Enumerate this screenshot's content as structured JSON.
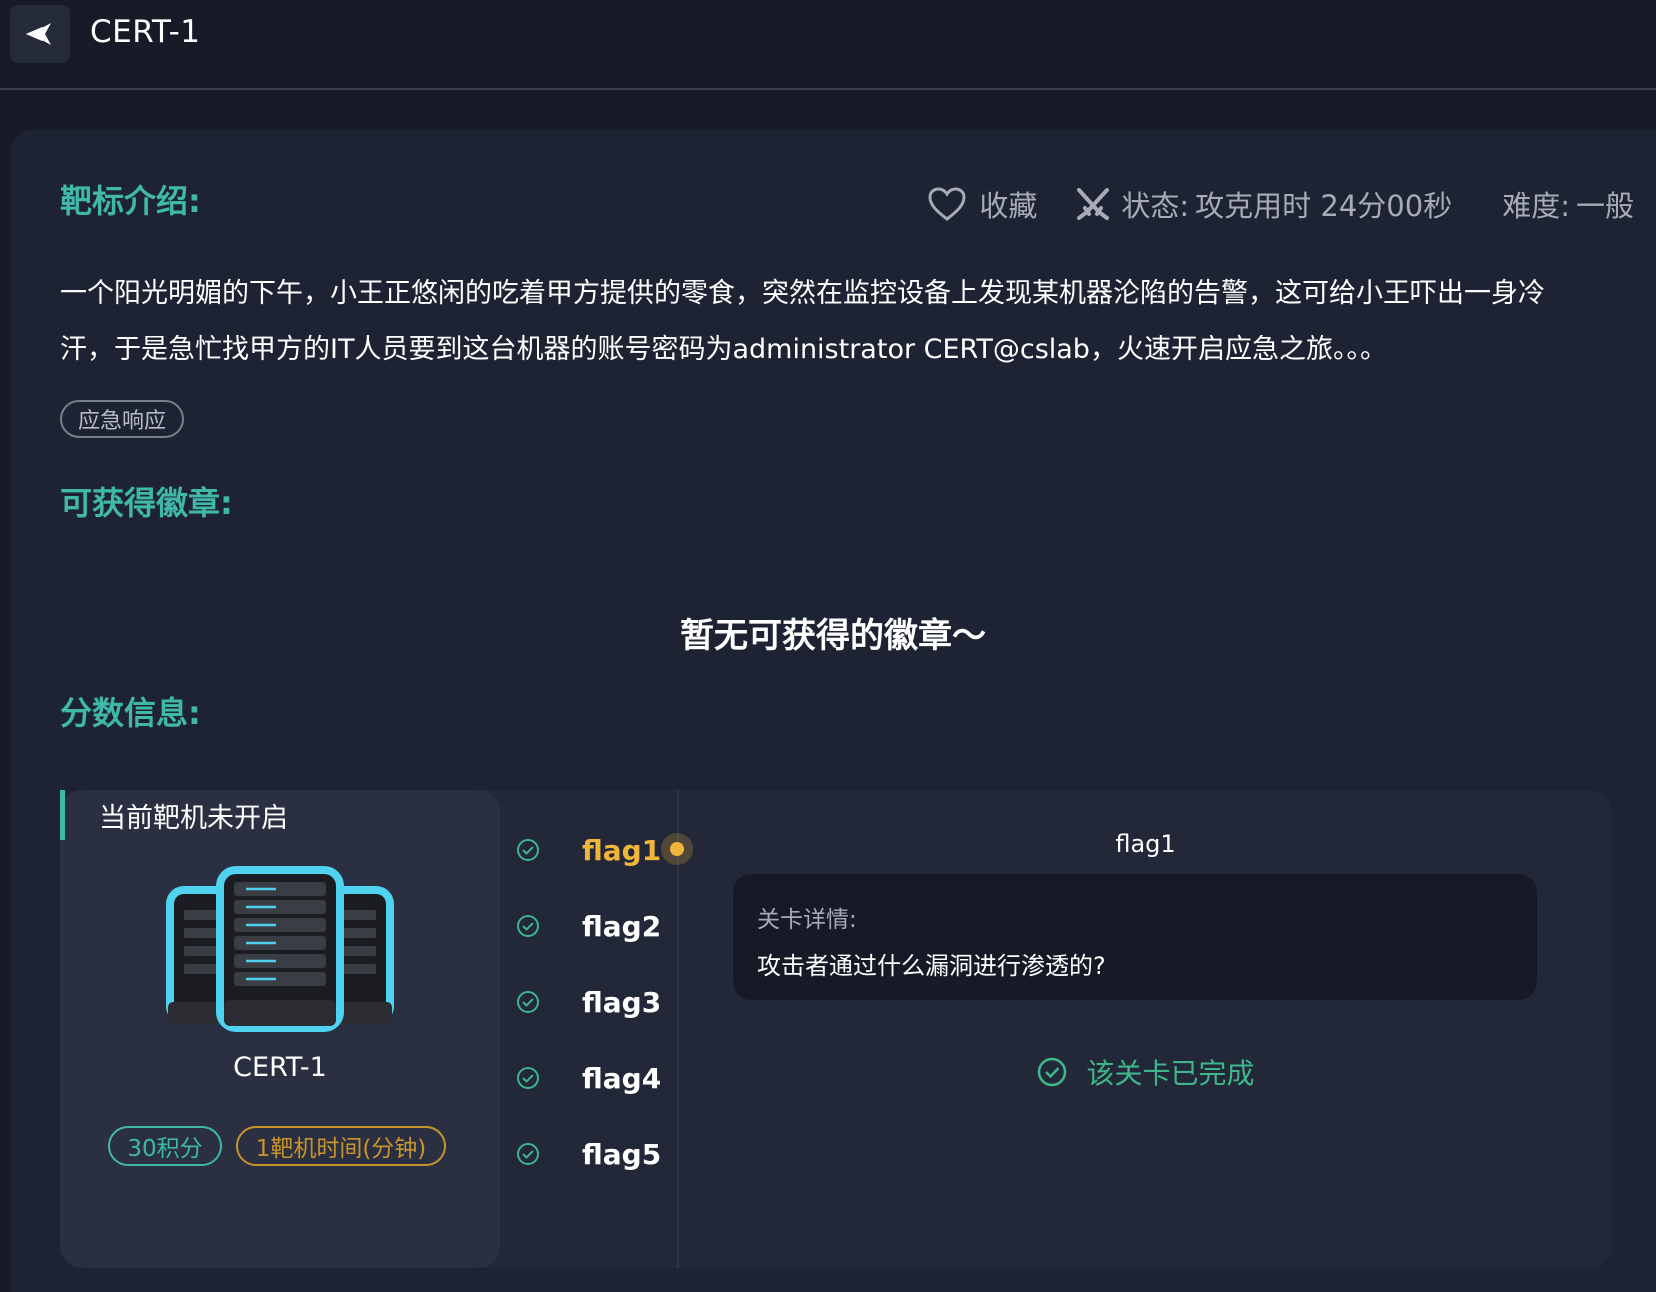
{
  "header": {
    "title": "CERT-1"
  },
  "intro": {
    "section_title": "靶标介绍:",
    "favorite_label": "收藏",
    "status_label": "状态:",
    "status_value": "攻克用时 24分00秒",
    "difficulty_label": "难度:",
    "difficulty_value": "一般",
    "description_line1": "一个阳光明媚的下午，小王正悠闲的吃着甲方提供的零食，突然在监控设备上发现某机器沦陷的告警，这可给小王吓出一身冷",
    "description_line2": "汗，于是急忙找甲方的IT人员要到这台机器的账号密码为administrator CERT@cslab，火速开启应急之旅。。。",
    "tag": "应急响应"
  },
  "badges": {
    "section_title": "可获得徽章:",
    "empty_text": "暂无可获得的徽章～"
  },
  "score": {
    "section_title": "分数信息:",
    "machine_status": "当前靶机未开启",
    "machine_name": "CERT-1",
    "points": "30积分",
    "machine_time": "1靶机时间(分钟)",
    "flags": [
      {
        "label": "flag1",
        "active": true
      },
      {
        "label": "flag2",
        "active": false
      },
      {
        "label": "flag3",
        "active": false
      },
      {
        "label": "flag4",
        "active": false
      },
      {
        "label": "flag5",
        "active": false
      }
    ],
    "detail_title": "flag1",
    "detail_label": "关卡详情:",
    "detail_question": "攻击者通过什么漏洞进行渗透的?",
    "completed_text": "该关卡已完成"
  },
  "colors": {
    "accent_teal": "#3fb8a8",
    "flag_active": "#f0b63a",
    "time_pill": "#c8942c",
    "complete_green": "#3fb58a"
  },
  "icons": {
    "back": "back-arrow-icon",
    "favorite": "heart-icon",
    "status": "crossed-swords-icon",
    "flag_done": "check-circle-icon",
    "server": "server-rack-icon"
  }
}
